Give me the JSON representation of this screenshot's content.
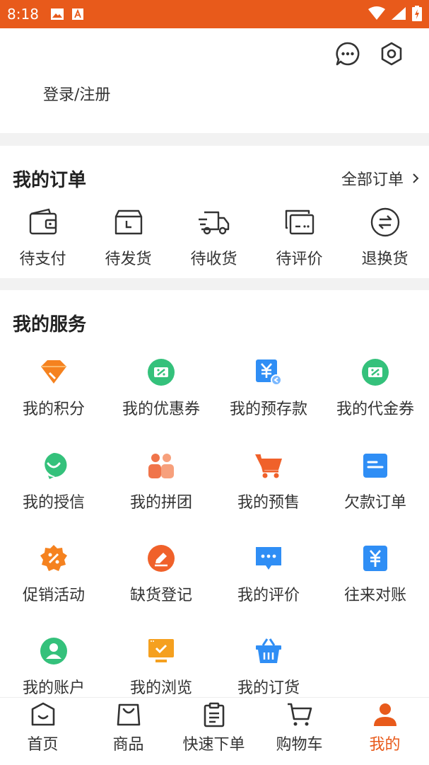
{
  "status_bar": {
    "time": "8:18"
  },
  "header": {
    "login_text": "登录/注册"
  },
  "orders": {
    "title": "我的订单",
    "all_orders_label": "全部订单",
    "items": [
      {
        "label": "待支付",
        "icon": "wallet-icon"
      },
      {
        "label": "待发货",
        "icon": "package-clock-icon"
      },
      {
        "label": "待收货",
        "icon": "truck-icon"
      },
      {
        "label": "待评价",
        "icon": "review-icon"
      },
      {
        "label": "退换货",
        "icon": "exchange-icon"
      }
    ]
  },
  "services": {
    "title": "我的服务",
    "items": [
      {
        "label": "我的积分",
        "icon": "diamond-icon",
        "color": "#f5821f"
      },
      {
        "label": "我的优惠券",
        "icon": "coupon-icon",
        "color": "#34c17b"
      },
      {
        "label": "我的预存款",
        "icon": "yen-card-icon",
        "color": "#2f8ef5"
      },
      {
        "label": "我的代金券",
        "icon": "voucher-icon",
        "color": "#34c17b"
      },
      {
        "label": "我的授信",
        "icon": "smile-chat-icon",
        "color": "#34c17b"
      },
      {
        "label": "我的拼团",
        "icon": "group-icon",
        "color": "#f0744a"
      },
      {
        "label": "我的预售",
        "icon": "cart-icon",
        "color": "#f0612a"
      },
      {
        "label": "欠款订单",
        "icon": "note-icon",
        "color": "#2f8ef5"
      },
      {
        "label": "促销活动",
        "icon": "discount-badge-icon",
        "color": "#f5821f"
      },
      {
        "label": "缺货登记",
        "icon": "edit-circle-icon",
        "color": "#f0612a"
      },
      {
        "label": "我的评价",
        "icon": "chat-bubble-icon",
        "color": "#2f8ef5"
      },
      {
        "label": "往来对账",
        "icon": "yen-doc-icon",
        "color": "#2f8ef5"
      },
      {
        "label": "我的账户",
        "icon": "user-circle-icon",
        "color": "#34c17b"
      },
      {
        "label": "我的浏览",
        "icon": "monitor-check-icon",
        "color": "#f5a01f"
      },
      {
        "label": "我的订货",
        "icon": "basket-icon",
        "color": "#2f8ef5"
      }
    ]
  },
  "bottom_nav": {
    "items": [
      {
        "label": "首页",
        "icon": "home-icon"
      },
      {
        "label": "商品",
        "icon": "shopping-bag-icon"
      },
      {
        "label": "快速下单",
        "icon": "clipboard-icon"
      },
      {
        "label": "购物车",
        "icon": "cart-outline-icon"
      },
      {
        "label": "我的",
        "icon": "profile-icon"
      }
    ],
    "active_color": "#e85a1b"
  }
}
